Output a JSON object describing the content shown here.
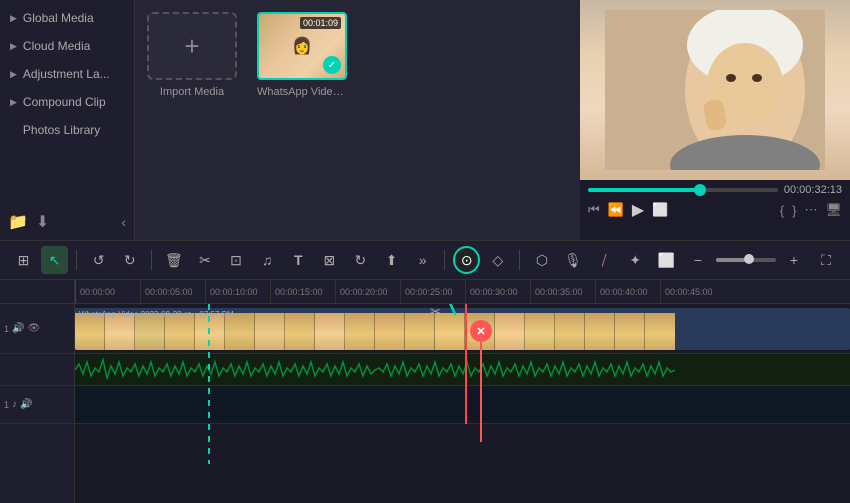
{
  "sidebar": {
    "items": [
      {
        "id": "global-media",
        "label": "Global Media",
        "arrow": "▶"
      },
      {
        "id": "cloud-media",
        "label": "Cloud Media",
        "arrow": "▶"
      },
      {
        "id": "adjustment",
        "label": "Adjustment La...",
        "arrow": "▶"
      },
      {
        "id": "compound-clip",
        "label": "Compound Clip",
        "arrow": "▶"
      },
      {
        "id": "photos-library",
        "label": "Photos Library",
        "arrow": ""
      }
    ]
  },
  "media_browser": {
    "import_label": "Import Media",
    "import_plus": "+",
    "video": {
      "name": "WhatsApp Video 202...",
      "duration": "00:01:09",
      "check": "✓"
    }
  },
  "preview": {
    "time": "00:00:32:13"
  },
  "toolbar": {
    "tools": [
      {
        "id": "layout",
        "icon": "⊞",
        "active": false
      },
      {
        "id": "select",
        "icon": "↖",
        "active": true
      },
      {
        "id": "undo",
        "icon": "↺",
        "active": false
      },
      {
        "id": "redo",
        "icon": "↻",
        "active": false
      },
      {
        "id": "delete",
        "icon": "🗑",
        "active": false
      },
      {
        "id": "cut",
        "icon": "✂",
        "active": false
      },
      {
        "id": "copy",
        "icon": "⊡",
        "active": false
      },
      {
        "id": "audio",
        "icon": "♫",
        "active": false
      },
      {
        "id": "text",
        "icon": "T",
        "active": false
      },
      {
        "id": "crop",
        "icon": "⊠",
        "active": false
      },
      {
        "id": "rotate",
        "icon": "↻",
        "active": false
      },
      {
        "id": "export",
        "icon": "⬆",
        "active": false
      },
      {
        "id": "more1",
        "icon": "»",
        "active": false
      },
      {
        "id": "speed",
        "icon": "⊙",
        "active": true
      },
      {
        "id": "keyframe",
        "icon": "◇",
        "active": false
      },
      {
        "id": "marker",
        "icon": "⬡",
        "active": false
      },
      {
        "id": "mic",
        "icon": "🎙",
        "active": false
      },
      {
        "id": "split",
        "icon": "⧸",
        "active": false
      },
      {
        "id": "effect",
        "icon": "✦",
        "active": false
      },
      {
        "id": "subtitle",
        "icon": "⬜",
        "active": false
      }
    ],
    "zoom_minus": "−",
    "zoom_plus": "+",
    "fullscreen": "⛶"
  },
  "timeline": {
    "ruler_labels": [
      "00:00:00",
      "00:00:05:00",
      "00:00:10:00",
      "00:00:15:00",
      "00:00:20:00",
      "00:00:25:00",
      "00:00:30:00",
      "00:00:35:00",
      "00:00:40:00",
      "00:00:45:00"
    ],
    "tracks": [
      {
        "id": "video-1",
        "num": "1",
        "icons": [
          "🔊",
          "👁"
        ],
        "label": "WhatsApp Video 2023-09-28 at... 07:57 PM"
      },
      {
        "id": "music-1",
        "num": "1",
        "icons": [
          "🎵",
          "🔊"
        ]
      }
    ],
    "playhead_position": "00:00:30",
    "split_marker": "✕",
    "dashed_line_label": ""
  }
}
